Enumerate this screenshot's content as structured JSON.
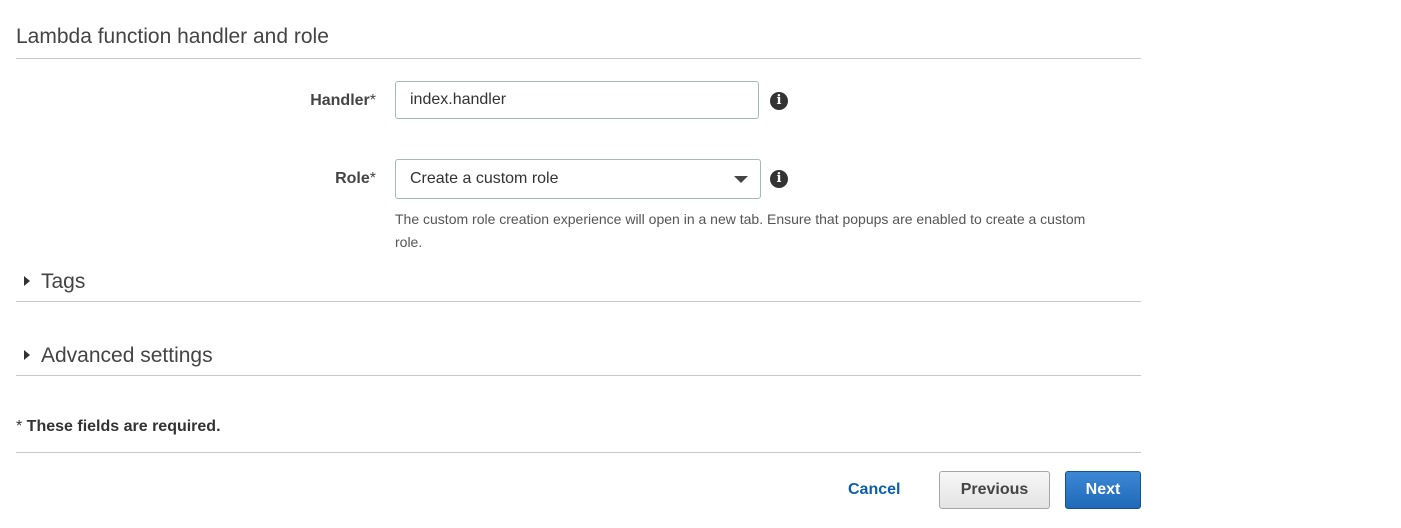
{
  "section": {
    "title": "Lambda function handler and role"
  },
  "handler": {
    "label": "Handler",
    "required_mark": "*",
    "value": "index.handler",
    "info_icon": "info-icon"
  },
  "role": {
    "label": "Role",
    "required_mark": "*",
    "selected": "Create a custom role",
    "info_icon": "info-icon",
    "hint": "The custom role creation experience will open in a new tab. Ensure that popups are enabled to create a custom role."
  },
  "tags": {
    "label": "Tags"
  },
  "advanced": {
    "label": "Advanced settings"
  },
  "footer": {
    "required_prefix": "* ",
    "required_text": "These fields are required.",
    "cancel": "Cancel",
    "previous": "Previous",
    "next": "Next"
  }
}
